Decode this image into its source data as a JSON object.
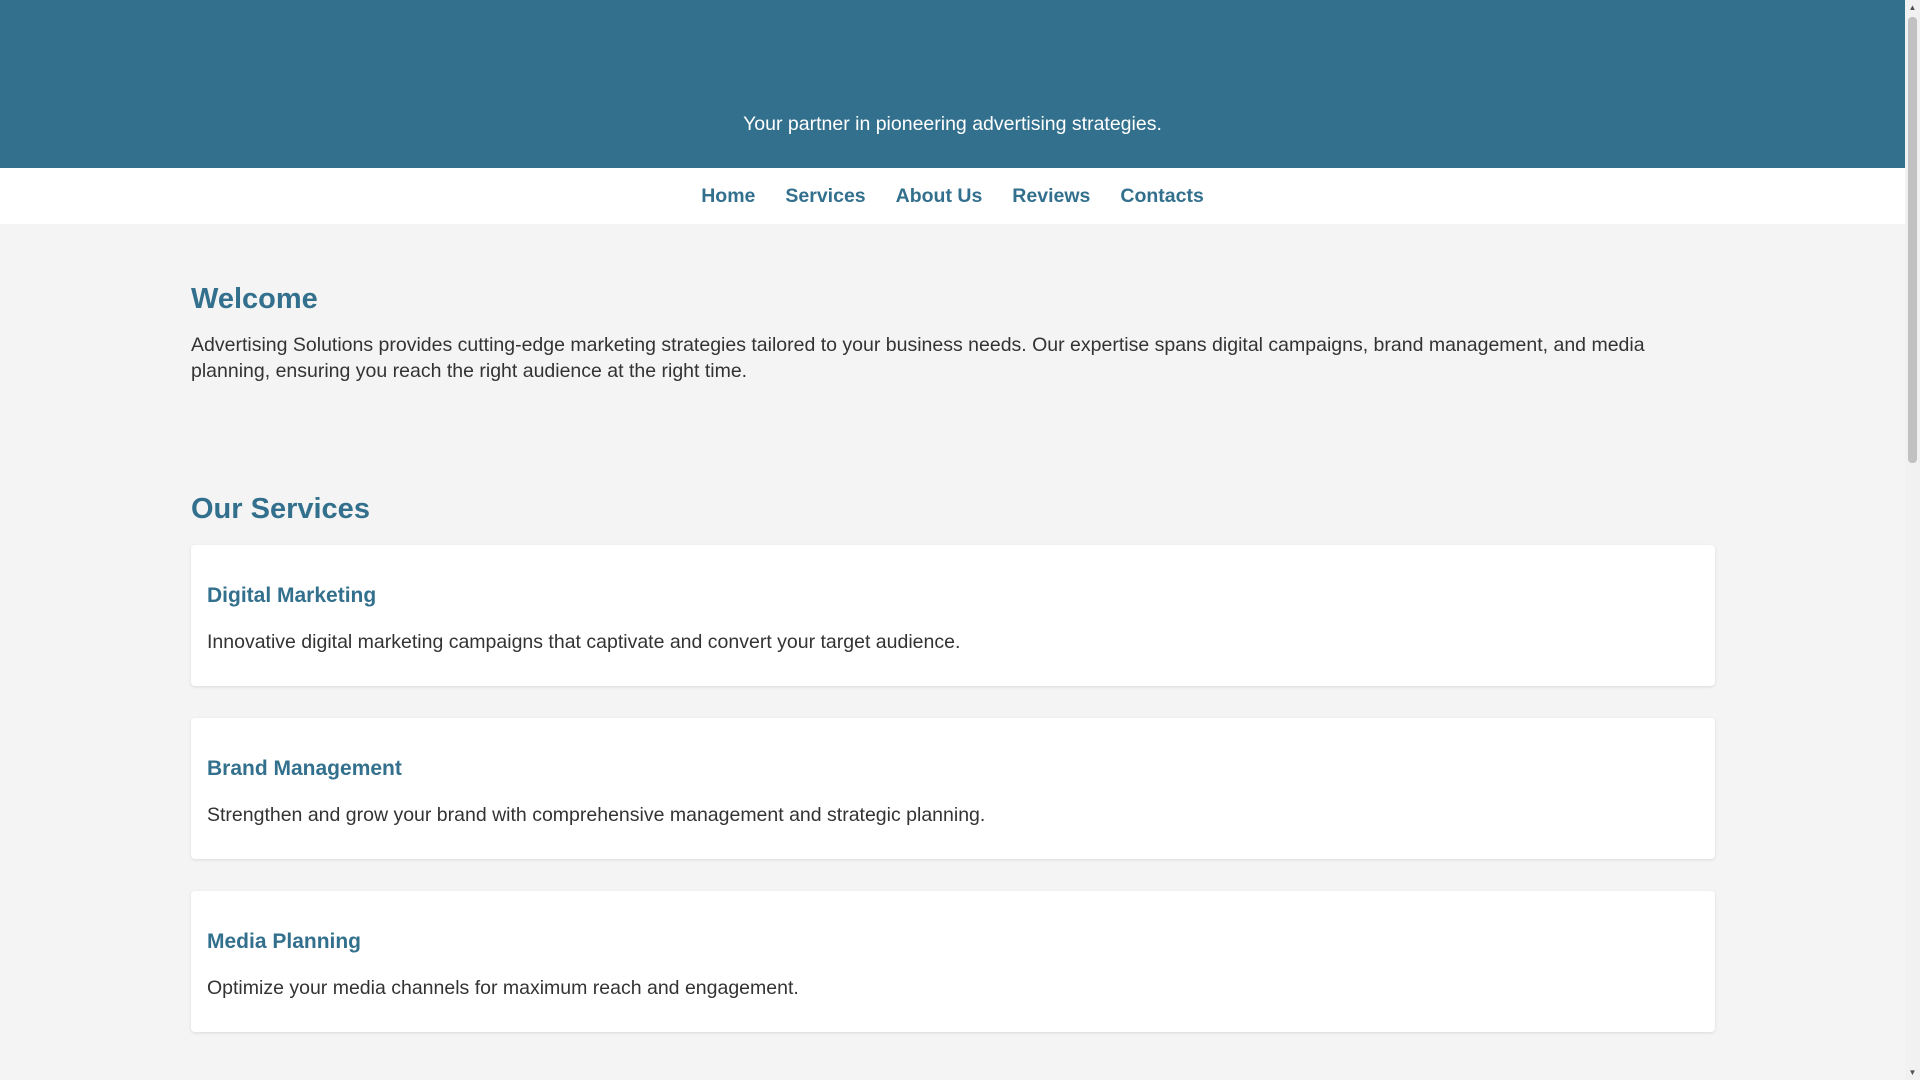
{
  "header": {
    "tagline": "Your partner in pioneering advertising strategies."
  },
  "nav": {
    "items": [
      {
        "label": "Home"
      },
      {
        "label": "Services"
      },
      {
        "label": "About Us"
      },
      {
        "label": "Reviews"
      },
      {
        "label": "Contacts"
      }
    ]
  },
  "welcome": {
    "title": "Welcome",
    "text": "Advertising Solutions provides cutting-edge marketing strategies tailored to your business needs. Our expertise spans digital campaigns, brand management, and media planning, ensuring you reach the right audience at the right time."
  },
  "services": {
    "title": "Our Services",
    "items": [
      {
        "title": "Digital Marketing",
        "description": "Innovative digital marketing campaigns that captivate and convert your target audience."
      },
      {
        "title": "Brand Management",
        "description": "Strengthen and grow your brand with comprehensive management and strategic planning."
      },
      {
        "title": "Media Planning",
        "description": "Optimize your media channels for maximum reach and engagement."
      }
    ]
  },
  "colors": {
    "brand": "#33708d",
    "background": "#f4f4f4",
    "card": "#ffffff",
    "text": "#333333"
  },
  "scrollbar": {
    "up_icon": "triangle-up-icon",
    "down_icon": "triangle-down-icon"
  }
}
